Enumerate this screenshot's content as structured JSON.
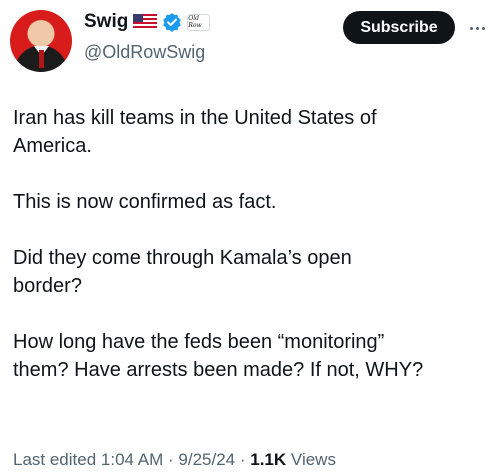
{
  "author": {
    "display_name": "Swig",
    "handle": "@OldRowSwig",
    "badges": [
      "us-flag-icon",
      "verified-icon",
      "affiliate-badge"
    ],
    "affiliate_label": "Old Row"
  },
  "actions": {
    "subscribe_label": "Subscribe"
  },
  "tweet": {
    "paragraphs": [
      "Iran has kill teams in the United States of\nAmerica.",
      "This is now confirmed as fact.",
      "Did they come through Kamala’s open\nborder?",
      "How long have the feds been “monitoring”\nthem?  Have arrests been made? If not, WHY?"
    ]
  },
  "meta": {
    "edited_prefix": "Last edited",
    "time": "1:04 AM",
    "separator": " · ",
    "date": "9/25/24",
    "views_count": "1.1K",
    "views_label": "Views"
  },
  "colors": {
    "text": "#0f1419",
    "secondary": "#536471",
    "verified": "#1d9bf0",
    "avatar_bg": "#d81c1c"
  }
}
